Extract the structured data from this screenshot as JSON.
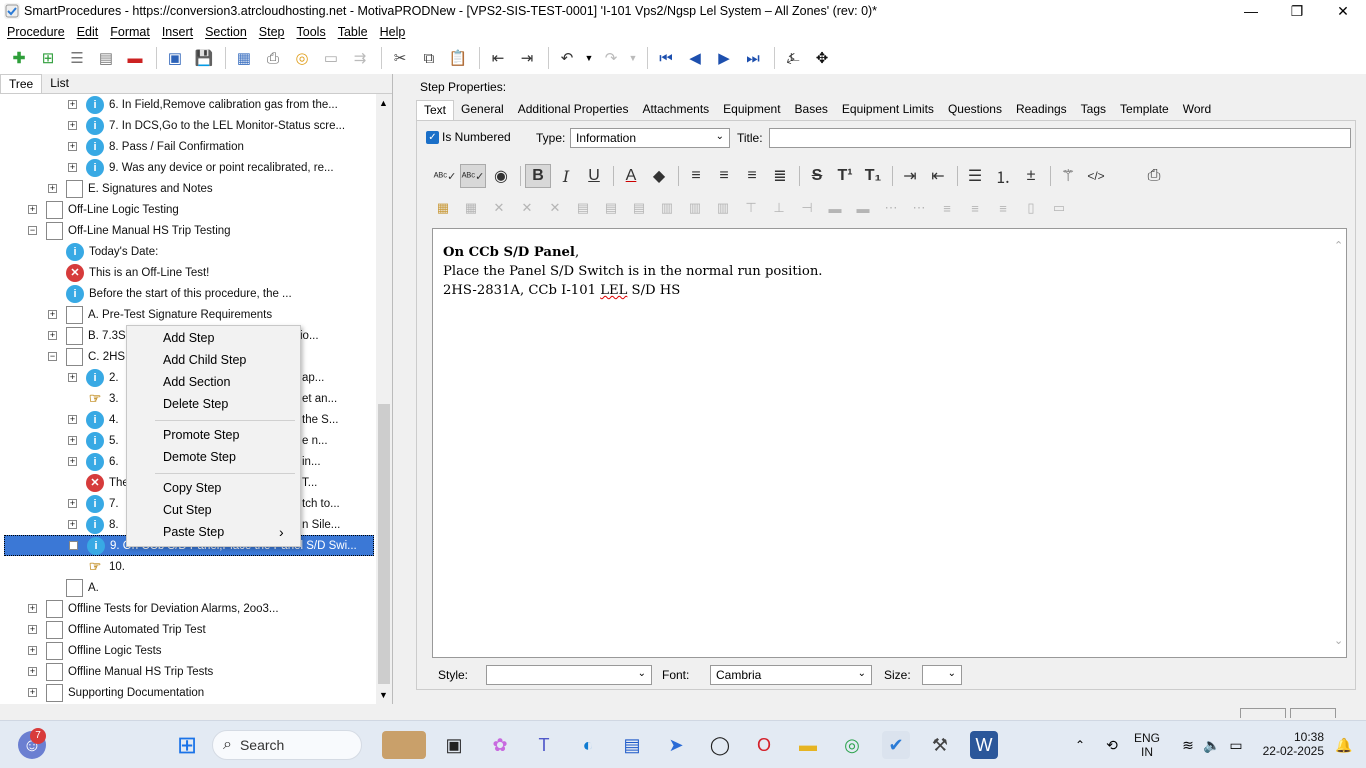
{
  "window": {
    "title": "SmartProcedures - https://conversion3.atrcloudhosting.net - MotivaPRODNew - [VPS2-SIS-TEST-0001] 'I-101 Vps2/Ngsp Lel System – All Zones' (rev: 0)*",
    "minimize": "—",
    "restore": "❐",
    "close": "✕"
  },
  "menu": [
    "Procedure",
    "Edit",
    "Format",
    "Insert",
    "Section",
    "Step",
    "Tools",
    "Table",
    "Help"
  ],
  "left_tabs": [
    "Tree",
    "List"
  ],
  "tree": [
    {
      "indent": 2,
      "icon": "info",
      "text": "6. In Field,Remove calibration gas from the...",
      "exp": "+"
    },
    {
      "indent": 2,
      "icon": "info",
      "text": "7. In DCS,Go to the LEL Monitor-Status scre...",
      "exp": "+"
    },
    {
      "indent": 2,
      "icon": "info",
      "text": "8. Pass / Fail Confirmation",
      "exp": "+"
    },
    {
      "indent": 2,
      "icon": "info",
      "text": "9. Was any device or point recalibrated, re...",
      "exp": "+"
    },
    {
      "indent": 1,
      "icon": "doc",
      "text": "E. Signatures and Notes",
      "exp": "+"
    },
    {
      "indent": 0,
      "icon": "doc",
      "text": "Off-Line Logic Testing",
      "exp": "+"
    },
    {
      "indent": 0,
      "icon": "doc",
      "text": "Off-Line Manual HS Trip Testing",
      "exp": "−"
    },
    {
      "indent": 1,
      "icon": "info",
      "text": "Today's Date:",
      "exp": ""
    },
    {
      "indent": 1,
      "icon": "x",
      "text": "This is an Off-Line Test!",
      "exp": ""
    },
    {
      "indent": 1,
      "icon": "info",
      "text": "Before the start of this procedure, the ...",
      "exp": ""
    },
    {
      "indent": 1,
      "icon": "doc",
      "text": "A. Pre-Test Signature Requirements",
      "exp": "+"
    },
    {
      "indent": 1,
      "icon": "doc",
      "text": "B. 7.3S",
      "tail": "io...",
      "exp": "+"
    },
    {
      "indent": 1,
      "icon": "doc",
      "text": "C. 2HS",
      "exp": "−"
    },
    {
      "indent": 2,
      "icon": "info",
      "text": "2. ",
      "tail": "ap...",
      "exp": "+"
    },
    {
      "indent": 2,
      "icon": "hand",
      "text": "3. ",
      "tail": "et an...",
      "exp": ""
    },
    {
      "indent": 2,
      "icon": "info",
      "text": "4. ",
      "tail": "the S...",
      "exp": "+"
    },
    {
      "indent": 2,
      "icon": "info",
      "text": "5. ",
      "tail": "e n...",
      "exp": "+"
    },
    {
      "indent": 2,
      "icon": "info",
      "text": "6. ",
      "tail": "in...",
      "exp": "+"
    },
    {
      "indent": 2,
      "icon": "x",
      "text": "The",
      "tail": "T...",
      "exp": ""
    },
    {
      "indent": 2,
      "icon": "info",
      "text": "7. ",
      "tail": "tch to...",
      "exp": "+"
    },
    {
      "indent": 2,
      "icon": "info",
      "text": "8. ",
      "tail": "n Sile...",
      "exp": "+"
    },
    {
      "indent": 2,
      "icon": "info",
      "text": "9. On CCb S/D Panel,Place the Panel S/D Swi...",
      "exp": "+",
      "selected": true
    },
    {
      "indent": 2,
      "icon": "hand",
      "text": "10.",
      "exp": ""
    },
    {
      "indent": 1,
      "icon": "doc",
      "text": "A.",
      "exp": ""
    },
    {
      "indent": 0,
      "icon": "doc",
      "text": "Offline Tests for Deviation Alarms, 2oo3...",
      "exp": "+"
    },
    {
      "indent": 0,
      "icon": "doc",
      "text": "Offline Automated Trip Test",
      "exp": "+"
    },
    {
      "indent": 0,
      "icon": "doc",
      "text": "Offline Logic Tests",
      "exp": "+"
    },
    {
      "indent": 0,
      "icon": "doc",
      "text": "Offline Manual HS Trip Tests",
      "exp": "+"
    },
    {
      "indent": 0,
      "icon": "doc",
      "text": "Supporting Documentation",
      "exp": "+"
    }
  ],
  "context_menu": {
    "add_step": "Add Step",
    "add_child_step": "Add Child Step",
    "add_section": "Add Section",
    "delete_step": "Delete Step",
    "promote_step": "Promote Step",
    "demote_step": "Demote Step",
    "copy_step": "Copy Step",
    "cut_step": "Cut Step",
    "paste_step": "Paste Step",
    "submenu_arrow": "›"
  },
  "step_properties": {
    "heading": "Step Properties:",
    "tabs": [
      "Text",
      "General",
      "Additional Properties",
      "Attachments",
      "Equipment",
      "Bases",
      "Equipment Limits",
      "Questions",
      "Readings",
      "Tags",
      "Template",
      "Word"
    ],
    "is_numbered_label": "Is Numbered",
    "is_numbered_checked": true,
    "type_label": "Type:",
    "type_value": "Information",
    "title_label": "Title:",
    "title_value": ""
  },
  "editor": {
    "line1_bold": "On CCb S/D Panel",
    "line1_rest": ",",
    "line2": "Place the Panel S/D Switch is in the normal run position.",
    "line3_a": "2HS-2831A, CCb I-101 ",
    "line3_spell": "LEL",
    "line3_b": " S/D HS"
  },
  "bottom": {
    "style_label": "Style:",
    "style_value": "",
    "font_label": "Font:",
    "font_value": "Cambria",
    "size_label": "Size:",
    "size_value": ""
  },
  "taskbar": {
    "search": "Search",
    "badge": "7",
    "lang1": "ENG",
    "lang2": "IN",
    "time": "10:38",
    "date": "22-02-2025"
  }
}
